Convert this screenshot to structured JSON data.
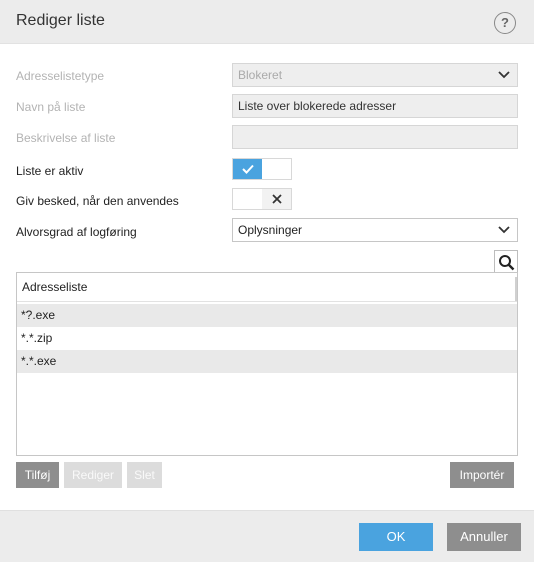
{
  "dialog": {
    "title": "Rediger liste",
    "help_icon": "?"
  },
  "form": {
    "list_type_label": "Adresselistetype",
    "list_type_value": "Blokeret",
    "list_name_label": "Navn på liste",
    "list_name_value": "Liste over blokerede adresser",
    "description_label": "Beskrivelse af liste",
    "description_value": "",
    "active_label": "Liste er aktiv",
    "active_value": true,
    "notify_label": "Giv besked, når den anvendes",
    "notify_value": false,
    "severity_label": "Alvorsgrad af logføring",
    "severity_value": "Oplysninger"
  },
  "table": {
    "header": "Adresseliste",
    "rows": [
      "*?.exe",
      "*.*.zip",
      "*.*.exe"
    ]
  },
  "actions": {
    "add": "Tilføj",
    "edit": "Rediger",
    "delete": "Slet",
    "import": "Importér"
  },
  "footer": {
    "ok": "OK",
    "cancel": "Annuller"
  },
  "colors": {
    "accent": "#4aa3df",
    "button_dark": "#8e8e8e",
    "header_bg": "#ececec"
  }
}
